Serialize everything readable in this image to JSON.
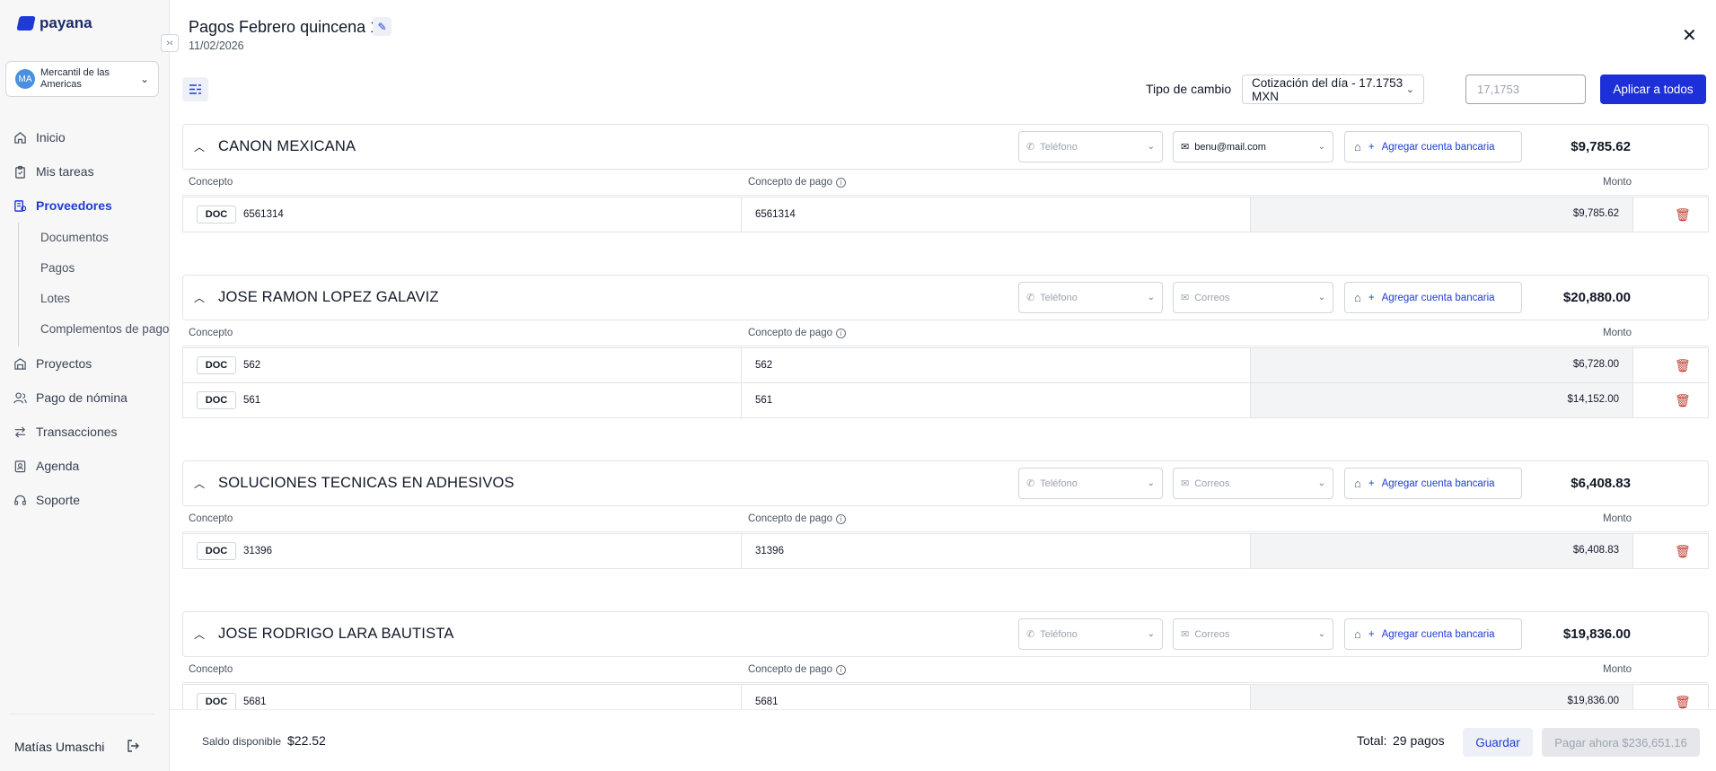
{
  "brand": {
    "name": "payana"
  },
  "company": {
    "initials": "MA",
    "name": "Mercantil de las Americas"
  },
  "nav": {
    "items": [
      {
        "label": "Inicio",
        "icon": "home-icon"
      },
      {
        "label": "Mis tareas",
        "icon": "clipboard-icon"
      },
      {
        "label": "Proveedores",
        "icon": "supplier-icon",
        "active": true
      },
      {
        "label": "Proyectos",
        "icon": "building-icon"
      },
      {
        "label": "Pago de nómina",
        "icon": "users-icon"
      },
      {
        "label": "Transacciones",
        "icon": "arrows-icon"
      },
      {
        "label": "Agenda",
        "icon": "contacts-icon"
      },
      {
        "label": "Soporte",
        "icon": "headset-icon"
      }
    ],
    "sub_items": [
      "Documentos",
      "Pagos",
      "Lotes",
      "Complementos de pago"
    ]
  },
  "user": {
    "name": "Matías Umaschi"
  },
  "header": {
    "title": "Pagos Febrero quincena 1",
    "date": "11/02/2026"
  },
  "exchange": {
    "label": "Tipo de cambio",
    "selected": "Cotización del día - 17.1753 MXN",
    "input_placeholder": "17,1753",
    "apply_label": "Aplicar a todos"
  },
  "columns": {
    "concept": "Concepto",
    "pay_concept": "Concepto de pago",
    "amount": "Monto"
  },
  "phone_placeholder": "Teléfono",
  "email_placeholder": "Correos",
  "bank_label": "Agregar cuenta bancaria",
  "doc_badge": "DOC",
  "groups": [
    {
      "name": "CANON MEXICANA",
      "email": "benu@mail.com",
      "total": "$9,785.62",
      "rows": [
        {
          "concept": "6561314",
          "pay_concept": "6561314",
          "amount": "$9,785.62"
        }
      ]
    },
    {
      "name": "JOSE RAMON LOPEZ GALAVIZ",
      "email": "",
      "total": "$20,880.00",
      "rows": [
        {
          "concept": "562",
          "pay_concept": "562",
          "amount": "$6,728.00"
        },
        {
          "concept": "561",
          "pay_concept": "561",
          "amount": "$14,152.00"
        }
      ]
    },
    {
      "name": "SOLUCIONES TECNICAS EN ADHESIVOS",
      "email": "",
      "total": "$6,408.83",
      "rows": [
        {
          "concept": "31396",
          "pay_concept": "31396",
          "amount": "$6,408.83"
        }
      ]
    },
    {
      "name": "JOSE RODRIGO LARA BAUTISTA",
      "email": "",
      "total": "$19,836.00",
      "rows": [
        {
          "concept": "5681",
          "pay_concept": "5681",
          "amount": "$19,836.00"
        }
      ]
    }
  ],
  "footer": {
    "saldo_label": "Saldo disponible",
    "saldo_value": "$22.52",
    "total_label": "Total:",
    "total_value": "29 pagos",
    "save_label": "Guardar",
    "pay_label": "Pagar ahora $236,651.16"
  },
  "colors": {
    "accent": "#1d2fd6",
    "danger": "#c0392b",
    "sidebar_bg": "#f7f7f8"
  }
}
